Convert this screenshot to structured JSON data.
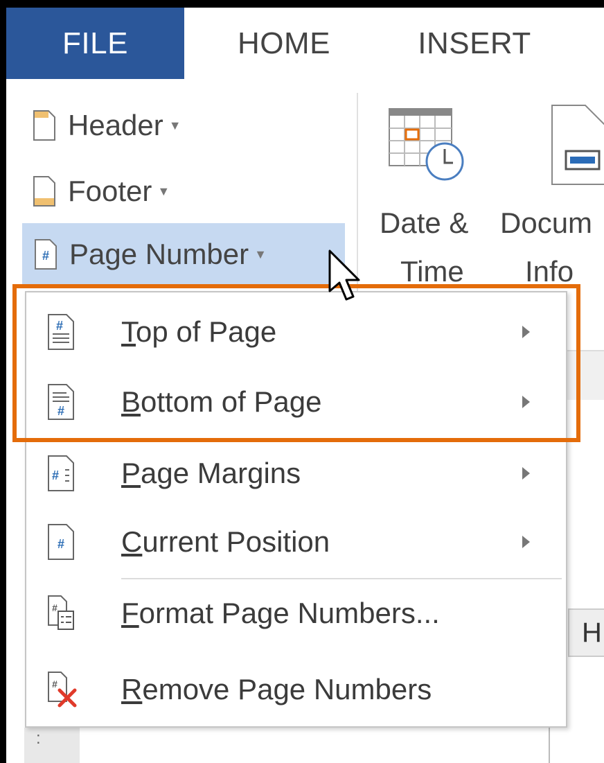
{
  "tabs": {
    "file": "FILE",
    "home": "HOME",
    "insert": "INSERT"
  },
  "ribbon": {
    "header_label": "Header",
    "footer_label": "Footer",
    "page_number_label": "Page Number",
    "date_time_line1": "Date &",
    "date_time_line2": "Time",
    "doc_info_line1": "Docum",
    "doc_info_line2": "Info"
  },
  "menu": {
    "items": [
      {
        "accel": "T",
        "rest": "op of Page",
        "icon": "page-number-top-icon",
        "submenu": true
      },
      {
        "accel": "B",
        "rest": "ottom of Page",
        "icon": "page-number-bottom-icon",
        "submenu": true
      },
      {
        "accel": "P",
        "rest": "age Margins",
        "icon": "page-number-margins-icon",
        "submenu": true
      },
      {
        "accel": "C",
        "rest": "urrent Position",
        "icon": "page-number-current-icon",
        "submenu": true
      },
      {
        "accel": "F",
        "rest": "ormat Page Numbers...",
        "icon": "format-page-numbers-icon",
        "submenu": false
      },
      {
        "accel": "R",
        "rest": "emove Page Numbers",
        "icon": "remove-page-numbers-icon",
        "submenu": false
      }
    ]
  },
  "background": {
    "h_fragment": "H",
    "dots": ":"
  },
  "colors": {
    "file_tab": "#2b579a",
    "selected_button": "#c6d9f1",
    "highlight_border": "#e46c0a",
    "remove_x": "#e03a2a",
    "hash_blue": "#2f6fb6",
    "header_footer_fill": "#f0c070"
  }
}
